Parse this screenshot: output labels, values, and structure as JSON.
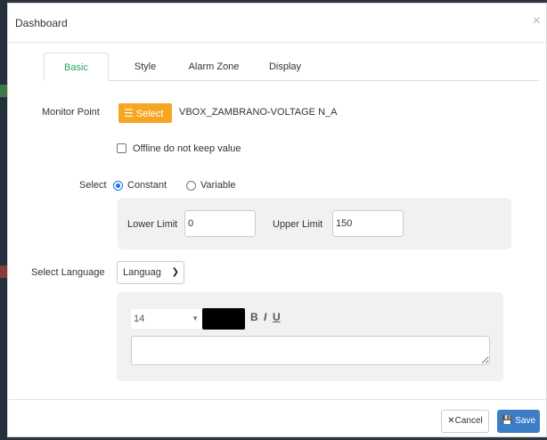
{
  "dialog": {
    "title": "Dashboard",
    "close_glyph": "×"
  },
  "tabs": [
    {
      "label": "Basic",
      "active": true
    },
    {
      "label": "Style",
      "active": false
    },
    {
      "label": "Alarm Zone",
      "active": false
    },
    {
      "label": "Display",
      "active": false
    }
  ],
  "monitor": {
    "label": "Monitor Point",
    "select_button": "Select",
    "select_icon": "list-icon",
    "value": "VBOX_ZAMBRANO-VOLTAGE N_A"
  },
  "offline": {
    "label": "Offline do not keep value",
    "checked": false
  },
  "select_mode": {
    "label": "Select",
    "options": [
      {
        "label": "Constant",
        "checked": true
      },
      {
        "label": "Variable",
        "checked": false
      }
    ]
  },
  "limits": {
    "lower_label": "Lower Limit",
    "lower_value": "0",
    "upper_label": "Upper Limit",
    "upper_value": "150"
  },
  "language": {
    "label": "Select Language",
    "selected": "Languag"
  },
  "text_style": {
    "font_size": "14",
    "color": "#000000",
    "bold": "B",
    "italic": "I",
    "underline": "U"
  },
  "footer": {
    "cancel_label": "Cancel",
    "save_label": "Save"
  },
  "colors": {
    "accent_green": "#2aa45b",
    "select_orange": "#f6a623",
    "save_blue": "#3d7ec7",
    "radio_blue": "#1a73e8"
  }
}
